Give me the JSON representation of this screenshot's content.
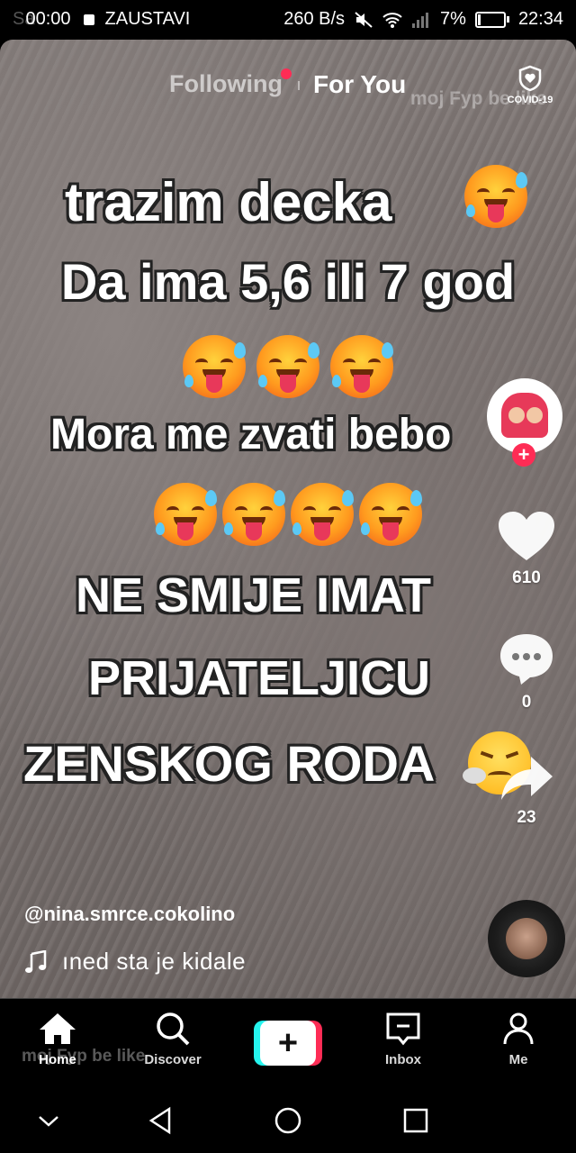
{
  "status_bar": {
    "ghost_text": "Sa",
    "record_time": "00:00",
    "stop_label": "ZAUSTAVI",
    "net_speed": "260 B/s",
    "battery": "7%",
    "clock": "22:34"
  },
  "feed_tabs": {
    "following": "Following",
    "for_you": "For You"
  },
  "covid": {
    "label": "COVID-19",
    "icon": "shield-heart-icon"
  },
  "watermark": "moj Fyp be like",
  "video_caption": {
    "line1": "trazim decka",
    "line2": "Da ima 5,6 ili 7 god",
    "line3": "Mora me zvati bebo",
    "line4": "NE SMIJE IMAT",
    "line5": "PRIJATELJICU",
    "line6": "ZENSKOG RODA"
  },
  "actions": {
    "likes": "610",
    "comments": "0",
    "shares": "23"
  },
  "author": {
    "username": "@nina.smrce.cokolino"
  },
  "music": {
    "icon": "music-note-icon",
    "title": "ıned    sta je kidale"
  },
  "bottom_nav": {
    "home": "Home",
    "discover": "Discover",
    "inbox": "Inbox",
    "me": "Me",
    "create": "+"
  },
  "colors": {
    "accent": "#fe2c55",
    "cyan": "#25f4ee"
  }
}
